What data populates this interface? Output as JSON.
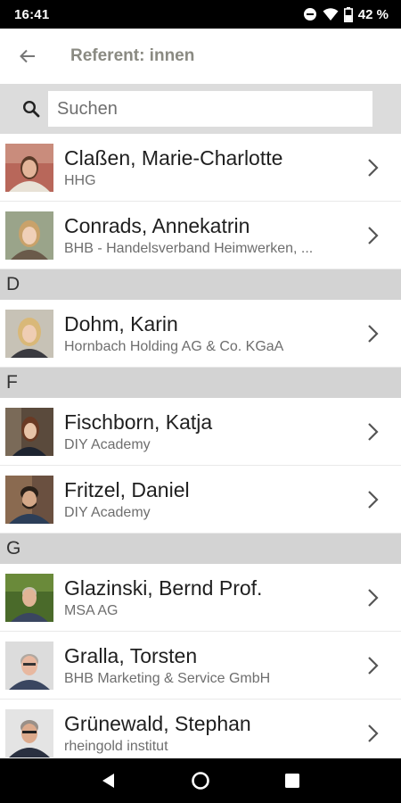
{
  "status": {
    "time": "16:41",
    "battery": "42 %"
  },
  "appbar": {
    "title": "Referent: innen"
  },
  "search": {
    "placeholder": "Suchen"
  },
  "list": {
    "rows_top": [
      {
        "name": "Claßen, Marie-Charlotte",
        "org": "HHG"
      },
      {
        "name": "Conrads, Annekatrin",
        "org": "BHB - Handelsverband Heimwerken, ..."
      }
    ],
    "section_d": {
      "letter": "D"
    },
    "rows_d": [
      {
        "name": "Dohm, Karin",
        "org": "Hornbach Holding AG & Co. KGaA"
      }
    ],
    "section_f": {
      "letter": "F"
    },
    "rows_f": [
      {
        "name": "Fischborn, Katja",
        "org": "DIY Academy"
      },
      {
        "name": "Fritzel, Daniel",
        "org": "DIY Academy"
      }
    ],
    "section_g": {
      "letter": "G"
    },
    "rows_g": [
      {
        "name": "Glazinski, Bernd Prof.",
        "org": "MSA AG"
      },
      {
        "name": "Gralla, Torsten",
        "org": "BHB Marketing & Service GmbH"
      },
      {
        "name": "Grünewald, Stephan",
        "org": "rheingold institut"
      }
    ]
  },
  "icons": {
    "back": "arrow-left-icon",
    "search": "search-icon",
    "chevron": "chevron-right-icon",
    "nav_back": "triangle-back-icon",
    "nav_home": "circle-home-icon",
    "nav_recents": "square-recents-icon"
  },
  "colors": {
    "section_bg": "#d3d3d3",
    "search_bg": "#dcdcdc",
    "title": "#8a8a82"
  }
}
